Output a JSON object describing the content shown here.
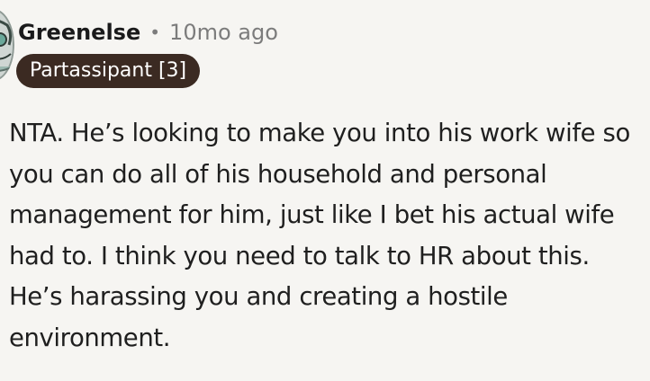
{
  "comment": {
    "author": "Greenelse",
    "separator": "•",
    "timestamp": "10mo ago",
    "flair": "Partassipant [3]",
    "avatar_icon": "user-avatar-icon",
    "flair_color": "#3b2a22",
    "background_color": "#f6f5f2",
    "body": "NTA. He’s looking to make you into his work wife so you can do all of his household and personal management for him, just like I bet his actual wife had to. I think you need to talk to HR about this. He’s harassing you and creating a hostile environment."
  }
}
